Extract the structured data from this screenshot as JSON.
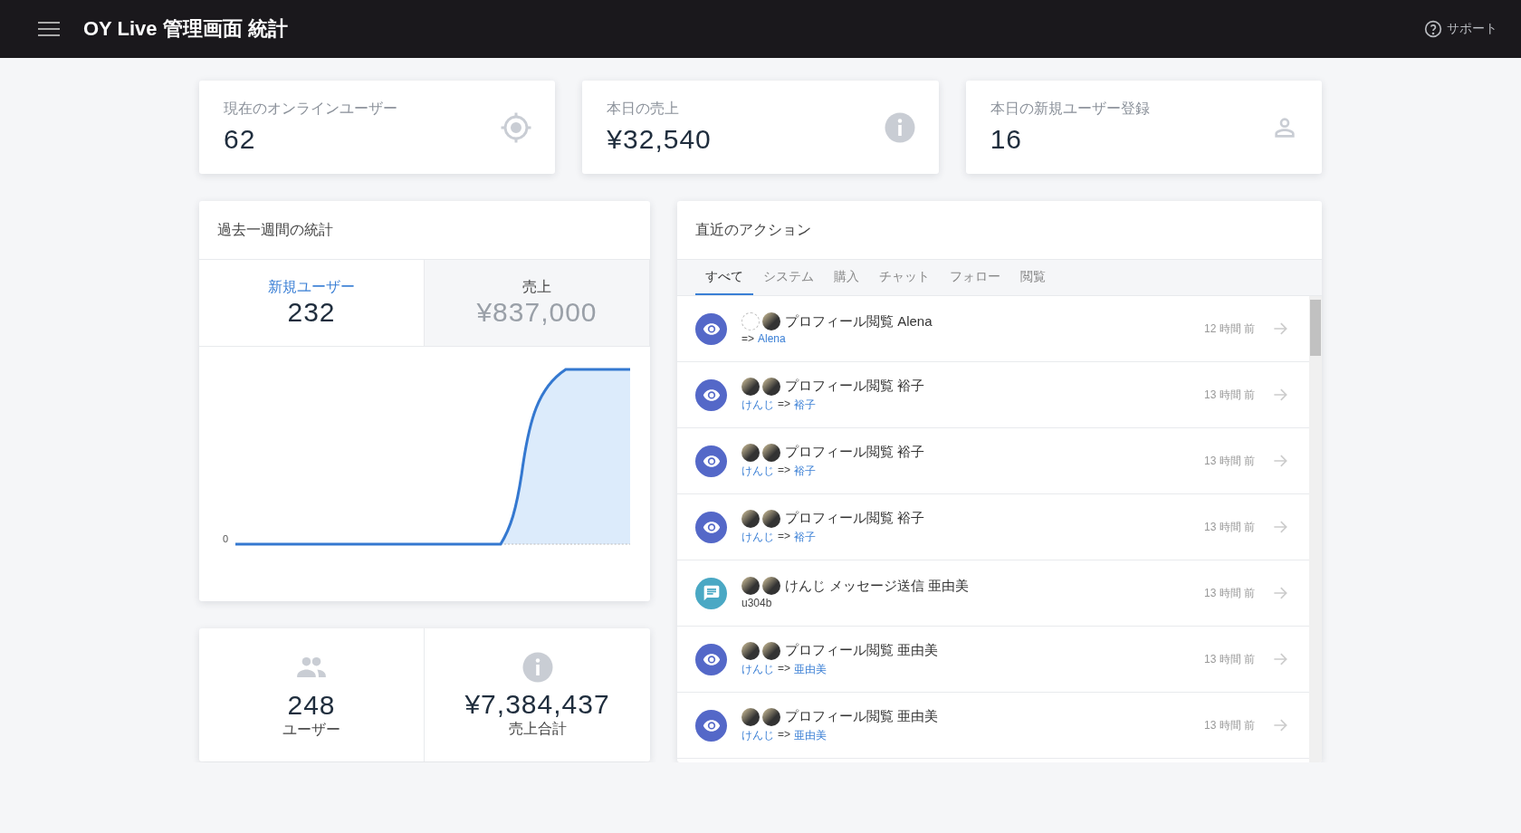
{
  "header": {
    "title": "OY Live 管理画面 統計",
    "support": "サポート"
  },
  "stat_cards": [
    {
      "label": "現在のオンラインユーザー",
      "value": "62",
      "kind": "target"
    },
    {
      "label": "本日の売上",
      "value": "¥32,540",
      "kind": "info"
    },
    {
      "label": "本日の新規ユーザー登録",
      "value": "16",
      "kind": "person"
    }
  ],
  "weekly": {
    "title": "過去一週間の統計",
    "metrics": [
      {
        "label": "新規ユーザー",
        "value": "232",
        "selected": true
      },
      {
        "label": "売上",
        "value": "¥837,000",
        "selected": false
      }
    ],
    "axis_label": "0"
  },
  "totals": [
    {
      "value": "248",
      "label": "ユーザー",
      "kind": "people"
    },
    {
      "value": "¥7,384,437",
      "label": "売上合計",
      "kind": "info"
    }
  ],
  "actions": {
    "title": "直近のアクション",
    "tabs": [
      {
        "label": "すべて",
        "selected": true
      },
      {
        "label": "システム",
        "selected": false
      },
      {
        "label": "購入",
        "selected": false
      },
      {
        "label": "チャット",
        "selected": false
      },
      {
        "label": "フォロー",
        "selected": false
      },
      {
        "label": "閲覧",
        "selected": false
      }
    ],
    "rows": [
      {
        "kind": "view",
        "avatars": [
          {
            "kind": "empty"
          },
          {
            "kind": "photo"
          }
        ],
        "title": "プロフィール閲覧 Alena",
        "arrow": "=>",
        "to": "Alena",
        "time": "12 時間 前"
      },
      {
        "kind": "view",
        "avatars": [
          {
            "kind": "photo"
          },
          {
            "kind": "photo"
          }
        ],
        "title": "プロフィール閲覧 裕子",
        "from": "けんじ",
        "arrow": "=>",
        "to": "裕子",
        "time": "13 時間 前"
      },
      {
        "kind": "view",
        "avatars": [
          {
            "kind": "photo"
          },
          {
            "kind": "photo"
          }
        ],
        "title": "プロフィール閲覧 裕子",
        "from": "けんじ",
        "arrow": "=>",
        "to": "裕子",
        "time": "13 時間 前"
      },
      {
        "kind": "view",
        "avatars": [
          {
            "kind": "photo"
          },
          {
            "kind": "photo"
          }
        ],
        "title": "プロフィール閲覧 裕子",
        "from": "けんじ",
        "arrow": "=>",
        "to": "裕子",
        "time": "13 時間 前"
      },
      {
        "kind": "chat",
        "avatars": [
          {
            "kind": "photo"
          },
          {
            "kind": "photo"
          }
        ],
        "title": "けんじ メッセージ送信 亜由美",
        "message": "u304b",
        "time": "13 時間 前"
      },
      {
        "kind": "view",
        "avatars": [
          {
            "kind": "photo"
          },
          {
            "kind": "photo"
          }
        ],
        "title": "プロフィール閲覧 亜由美",
        "from": "けんじ",
        "arrow": "=>",
        "to": "亜由美",
        "time": "13 時間 前"
      },
      {
        "kind": "view",
        "avatars": [
          {
            "kind": "photo"
          },
          {
            "kind": "photo"
          }
        ],
        "title": "プロフィール閲覧 亜由美",
        "from": "けんじ",
        "arrow": "=>",
        "to": "亜由美",
        "time": "13 時間 前"
      }
    ]
  }
}
